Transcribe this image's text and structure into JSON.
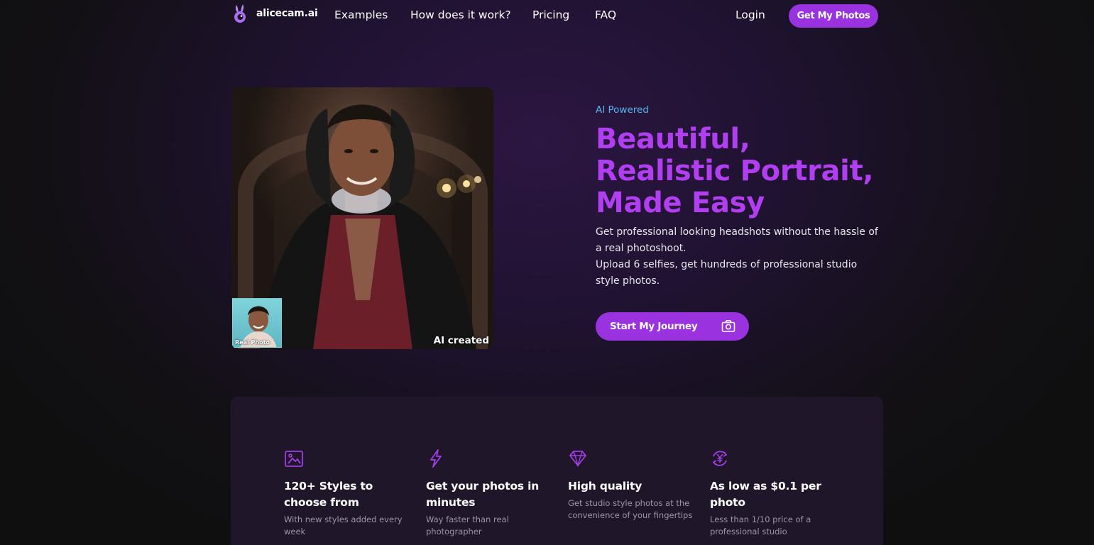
{
  "nav": {
    "brand": "alicecam.ai",
    "links": [
      "Examples",
      "How does it work?",
      "Pricing",
      "FAQ"
    ],
    "login": "Login",
    "cta": "Get My Photos"
  },
  "hero": {
    "eyebrow": "AI Powered",
    "headline": [
      "Beautiful,",
      "Realistic Portrait,",
      "Made Easy"
    ],
    "sub_lines": [
      "Get professional looking headshots without the hassle of a real photoshoot.",
      "Upload 6 selfies, get hundreds of professional studio style photos."
    ],
    "cta": "Start My Journey",
    "real_photo_label": "Real Photo",
    "ai_label": "AI created"
  },
  "features": [
    {
      "icon": "image-icon",
      "title": "120+ Styles to choose from",
      "desc": "With new styles added every week"
    },
    {
      "icon": "lightning-icon",
      "title": "Get your photos in minutes",
      "desc": "Way faster than real photographer"
    },
    {
      "icon": "diamond-icon",
      "title": "High quality",
      "desc": "Get studio style photos at the convenience of your fingertips"
    },
    {
      "icon": "yen-cycle-icon",
      "title": "As low as $0.1 per photo",
      "desc": "Less than 1/10 price of a professional studio"
    }
  ],
  "colors": {
    "accent": "#9a32e0",
    "headline": "#b23ef2",
    "eyebrow": "#55b4ee",
    "panel": "#1f1629"
  }
}
